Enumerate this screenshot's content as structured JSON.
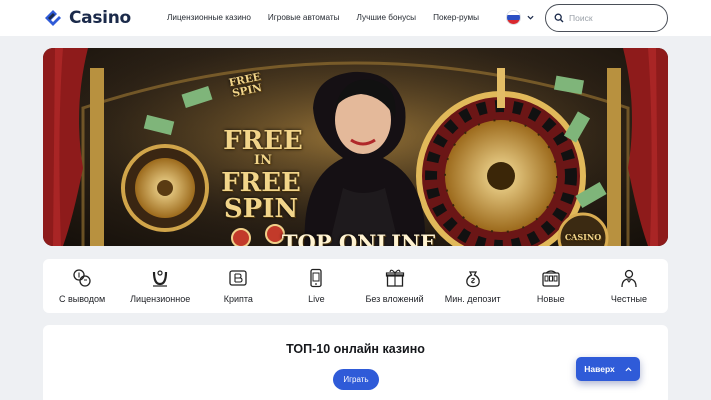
{
  "header": {
    "logo_text": "Casino",
    "nav": [
      {
        "label": "Лицензионные казино"
      },
      {
        "label": "Игровые автоматы"
      },
      {
        "label": "Лучшие бонусы"
      },
      {
        "label": "Покер-румы"
      }
    ],
    "language_flag": "russia-flag-icon",
    "search_placeholder": "Поиск"
  },
  "banner": {
    "text_free_spin_badge": "FREE SPIN",
    "text_free_in_free_spin": [
      "FREE",
      "IN",
      "FREE",
      "SPIN"
    ],
    "text_bottom": "TOP ONLINE",
    "text_sign": "CASINO"
  },
  "categories": [
    {
      "label": "С выводом",
      "icon": "coins-exchange-icon"
    },
    {
      "label": "Лицензионное",
      "icon": "horseshoe-icon"
    },
    {
      "label": "Крипта",
      "icon": "crypto-wallet-icon"
    },
    {
      "label": "Live",
      "icon": "mobile-live-icon"
    },
    {
      "label": "Без вложений",
      "icon": "gift-icon"
    },
    {
      "label": "Мин. депозит",
      "icon": "money-bag-icon"
    },
    {
      "label": "Новые",
      "icon": "slot-machine-icon"
    },
    {
      "label": "Честные",
      "icon": "dealer-icon"
    }
  ],
  "top_section": {
    "title": "ТОП-10 онлайн казино",
    "play_label": "Играть"
  },
  "scroll_top": {
    "label": "Наверх"
  },
  "colors": {
    "accent": "#2f5bd8",
    "logo": "#1b2a4a",
    "background": "#eef0f3"
  }
}
